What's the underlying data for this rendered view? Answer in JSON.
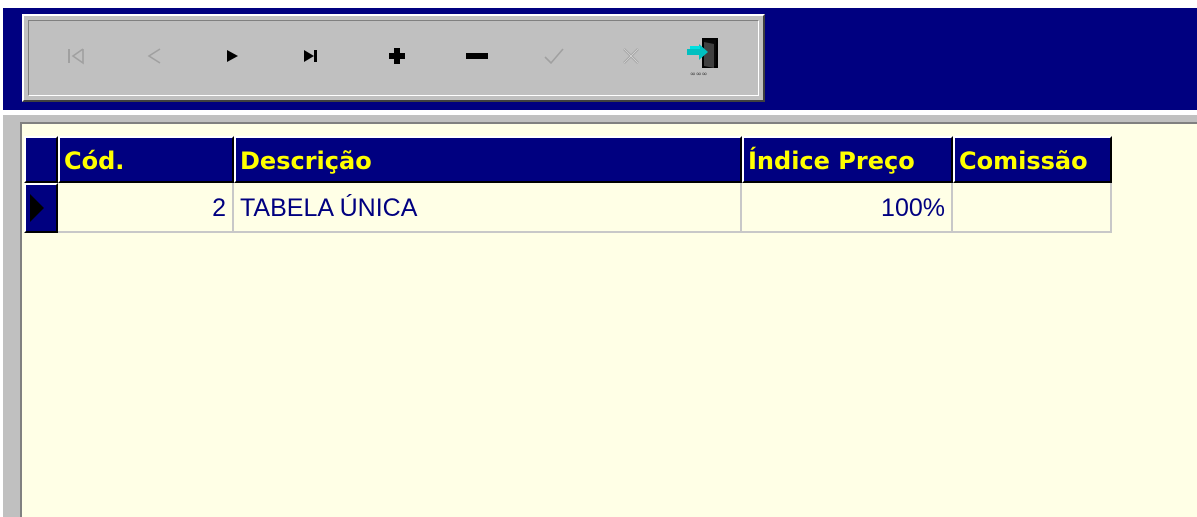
{
  "navigator": {
    "buttons": [
      {
        "name": "first-record",
        "enabled": false
      },
      {
        "name": "prior-record",
        "enabled": false
      },
      {
        "name": "next-record",
        "enabled": true
      },
      {
        "name": "last-record",
        "enabled": true
      },
      {
        "name": "insert-record",
        "enabled": true
      },
      {
        "name": "delete-record",
        "enabled": true
      },
      {
        "name": "post-edit",
        "enabled": false
      },
      {
        "name": "cancel-edit",
        "enabled": false
      },
      {
        "name": "exit",
        "enabled": true
      }
    ]
  },
  "grid": {
    "columns": [
      "Cód.",
      "Descrição",
      "Índice Preço",
      "Comissão"
    ],
    "rows": [
      {
        "cod": "2",
        "descricao": "TABELA ÚNICA",
        "indice_preco": "100%",
        "comissao": ""
      }
    ]
  },
  "colors": {
    "title_bar": "#000080",
    "header_text": "#ffff00",
    "grid_background": "#ffffe6",
    "cell_text": "#000080",
    "disabled_icon": "#a0a0a0"
  }
}
